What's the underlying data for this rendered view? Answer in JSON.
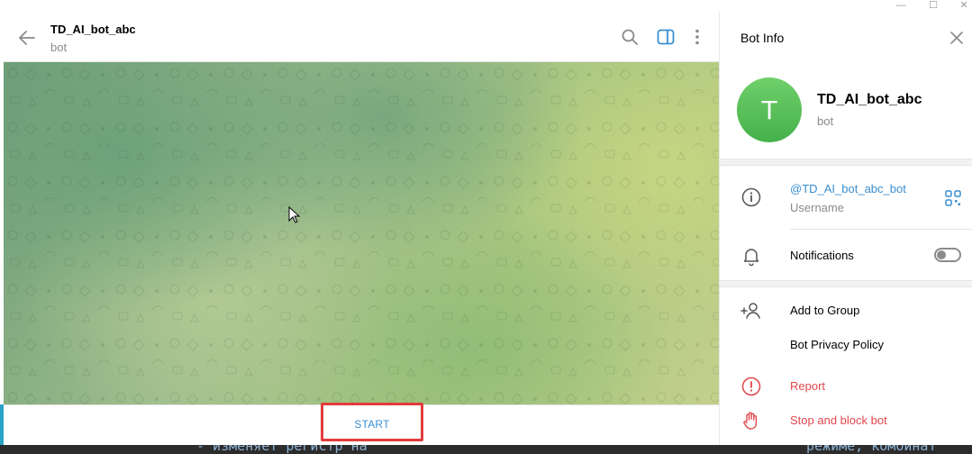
{
  "chat": {
    "title": "TD_AI_bot_abc",
    "status": "bot",
    "start_label": "START"
  },
  "info_panel": {
    "title": "Bot Info",
    "avatar_letter": "T",
    "name": "TD_AI_bot_abc",
    "status": "bot",
    "username": "@TD_AI_bot_abc_bot",
    "username_caption": "Username",
    "notifications_label": "Notifications",
    "notifications_on": false,
    "actions": {
      "add_to_group": "Add to Group",
      "privacy_policy": "Bot Privacy Policy",
      "report": "Report",
      "stop_block": "Stop and block bot"
    }
  },
  "background_text": {
    "left": "- изменяет регистр на",
    "right": "режиме, комбинат"
  },
  "colors": {
    "accent": "#3a8fd1",
    "danger": "#e0474c",
    "highlight_box": "#e23c3c",
    "avatar": "#52bb4f"
  },
  "icons": {
    "back": "arrow-left-icon",
    "search": "search-icon",
    "side_panel": "sidebar-toggle-icon",
    "more": "more-vertical-icon",
    "close": "close-icon",
    "info": "info-icon",
    "qr": "qr-code-icon",
    "bell": "bell-icon",
    "add_user": "add-user-icon",
    "report": "report-icon",
    "stop": "hand-stop-icon"
  }
}
